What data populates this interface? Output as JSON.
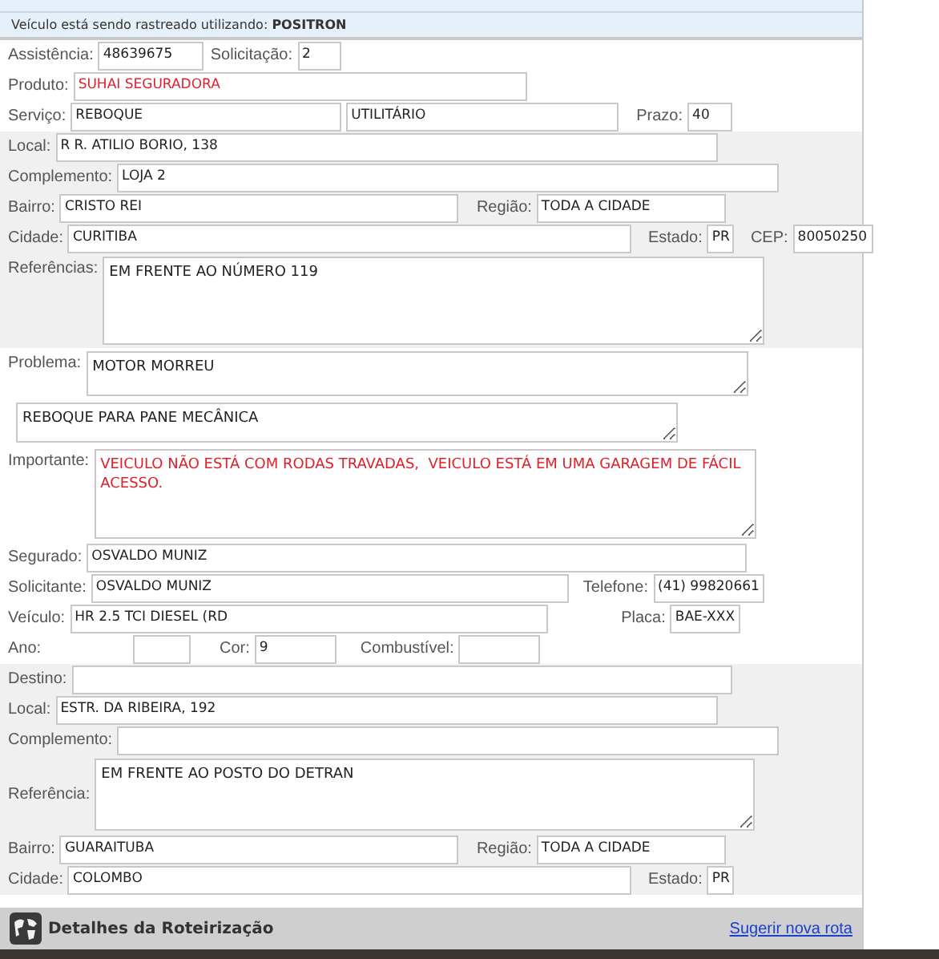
{
  "tracking_notice": {
    "text": "Veículo está sendo rastreado utilizando: **POSITRON**"
  },
  "sections": [
    {
      "shaded": false,
      "rows": [
        {
          "kind": "input",
          "fields": [
            {
              "label": "Assistência:",
              "value": "48639675"
            },
            {
              "label": "Solicitação:",
              "value": "2"
            }
          ]
        },
        {
          "kind": "input",
          "fields": [
            {
              "label": "Produto:",
              "value": "SUHAI SEGURADORA",
              "alert": true
            }
          ]
        },
        {
          "kind": "input",
          "fields": [
            {
              "label": "Serviço:",
              "value": "REBOQUE"
            },
            {
              "value": "UTILITÁRIO"
            },
            {
              "label": "Prazo:",
              "value": "40"
            }
          ]
        }
      ]
    },
    {
      "shaded": true,
      "rows": [
        {
          "kind": "input",
          "fields": [
            {
              "label": "Local:",
              "value": "R R. ATILIO BORIO, 138"
            }
          ]
        },
        {
          "kind": "input",
          "fields": [
            {
              "label": "Complemento:",
              "value": "LOJA 2"
            }
          ]
        },
        {
          "kind": "input",
          "fields": [
            {
              "label": "Bairro:",
              "value": "CRISTO REI"
            },
            {
              "label": "Região:",
              "value": "TODA A CIDADE"
            }
          ]
        },
        {
          "kind": "input",
          "fields": [
            {
              "label": "Cidade:",
              "value": "CURITIBA"
            },
            {
              "label": "Estado:",
              "value": "PR"
            },
            {
              "label": "CEP:",
              "value": "80050250"
            }
          ]
        },
        {
          "kind": "textarea",
          "fields": [
            {
              "label": "Referências:",
              "value": "EM FRENTE AO NÚMERO 119"
            }
          ]
        }
      ]
    },
    {
      "shaded": false,
      "rows": [
        {
          "kind": "textarea",
          "fields": [
            {
              "label": "Problema:",
              "value": "MOTOR MORREU"
            }
          ]
        },
        {
          "kind": "textarea",
          "fields": [
            {
              "value": "REBOQUE PARA PANE MECÂNICA"
            }
          ]
        },
        {
          "kind": "textarea",
          "fields": [
            {
              "label": "Importante:",
              "value": "VEICULO NÃO ESTÁ COM RODAS TRAVADAS,  VEICULO ESTÁ EM UMA GARAGEM DE FÁCIL ACESSO.",
              "alert": true
            }
          ]
        },
        {
          "kind": "input",
          "fields": [
            {
              "label": "Segurado:",
              "value": "OSVALDO MUNIZ"
            }
          ]
        },
        {
          "kind": "input",
          "fields": [
            {
              "label": "Solicitante:",
              "value": "OSVALDO MUNIZ"
            },
            {
              "label": "Telefone:",
              "value": "(41) 99820661"
            }
          ]
        },
        {
          "kind": "input",
          "fields": [
            {
              "label": "Veículo:",
              "value": "HR 2.5 TCI DIESEL (RD"
            },
            {
              "label": "Placa:",
              "value": "BAE-XXX"
            }
          ]
        },
        {
          "kind": "input",
          "fields": [
            {
              "label": "Ano:"
            },
            {
              "label": "Cor:",
              "value": "9"
            },
            {
              "label": "Combustível:"
            }
          ]
        }
      ]
    },
    {
      "shaded": true,
      "rows": [
        {
          "kind": "input",
          "fields": [
            {
              "label": "Destino:"
            }
          ]
        },
        {
          "kind": "input",
          "fields": [
            {
              "label": "Local:",
              "value": "ESTR. DA RIBEIRA, 192"
            }
          ]
        },
        {
          "kind": "input",
          "fields": [
            {
              "label": "Complemento:"
            }
          ]
        },
        {
          "kind": "textarea",
          "fields": [
            {
              "label": "Referência:",
              "value": "EM FRENTE AO POSTO DO DETRAN"
            }
          ]
        },
        {
          "kind": "input",
          "fields": [
            {
              "label": "Bairro:",
              "value": "GUARAITUBA"
            },
            {
              "label": "Região:",
              "value": "TODA A CIDADE"
            }
          ]
        },
        {
          "kind": "input",
          "fields": [
            {
              "label": "Cidade:",
              "value": "COLOMBO"
            },
            {
              "label": "Estado:",
              "value": "PR"
            }
          ]
        }
      ]
    }
  ],
  "footer": {
    "title": "Detalhes da Roteirização",
    "link": "Sugerir nova rota"
  }
}
